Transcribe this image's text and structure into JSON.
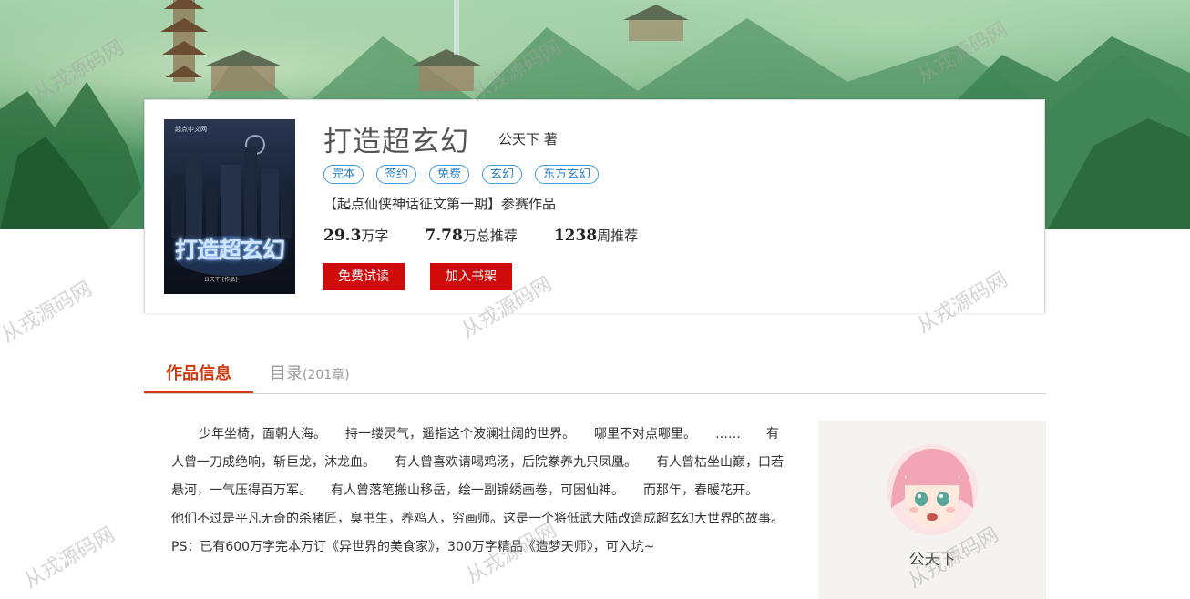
{
  "book": {
    "title": "打造超玄幻",
    "author_line": "公天下 著",
    "tags": [
      "完本",
      "签约",
      "免费",
      "玄幻",
      "东方玄幻"
    ],
    "contest": "【起点仙侠神话征文第一期】参赛作品",
    "stats": [
      {
        "num": "29.3",
        "unit": "万字"
      },
      {
        "num": "7.78",
        "unit": "万总推荐"
      },
      {
        "num": "1238",
        "unit": "周推荐"
      }
    ],
    "read_button": "免费试读",
    "shelf_button": "加入书架"
  },
  "cover": {
    "publisher": "起点中文网",
    "title": "打造超玄幻",
    "author": "公天下 [作品]"
  },
  "tabs": {
    "info": "作品信息",
    "catalog": "目录",
    "catalog_count": "(201章)"
  },
  "intro": "少年坐椅，面朝大海。　　持一缕灵气，遥指这个波澜壮阔的世界。　　哪里不对点哪里。　　……　　有人曾一刀成绝响，斩巨龙，沐龙血。　　有人曾喜欢请喝鸡汤，后院豢养九只凤凰。　　有人曾枯坐山巅，口若悬河，一气压得百万军。　　有人曾落笔搬山移岳，绘一副锦绣画卷，可困仙神。　　而那年，春暖花开。　　他们不过是平凡无奇的杀猪匠，臭书生，养鸡人，穷画师。这是一个将低武大陆改造成超玄幻大世界的故事。　　PS：已有600万字完本万订《异世界的美食家》，300万字精品《造梦天师》，可入坑~",
  "author_panel": {
    "name": "公天下"
  },
  "watermark": "从戎源码网",
  "colors": {
    "accent_red": "#cf0a0a",
    "tab_active": "#cf3a0e",
    "tag_blue": "#2b7fc4"
  }
}
